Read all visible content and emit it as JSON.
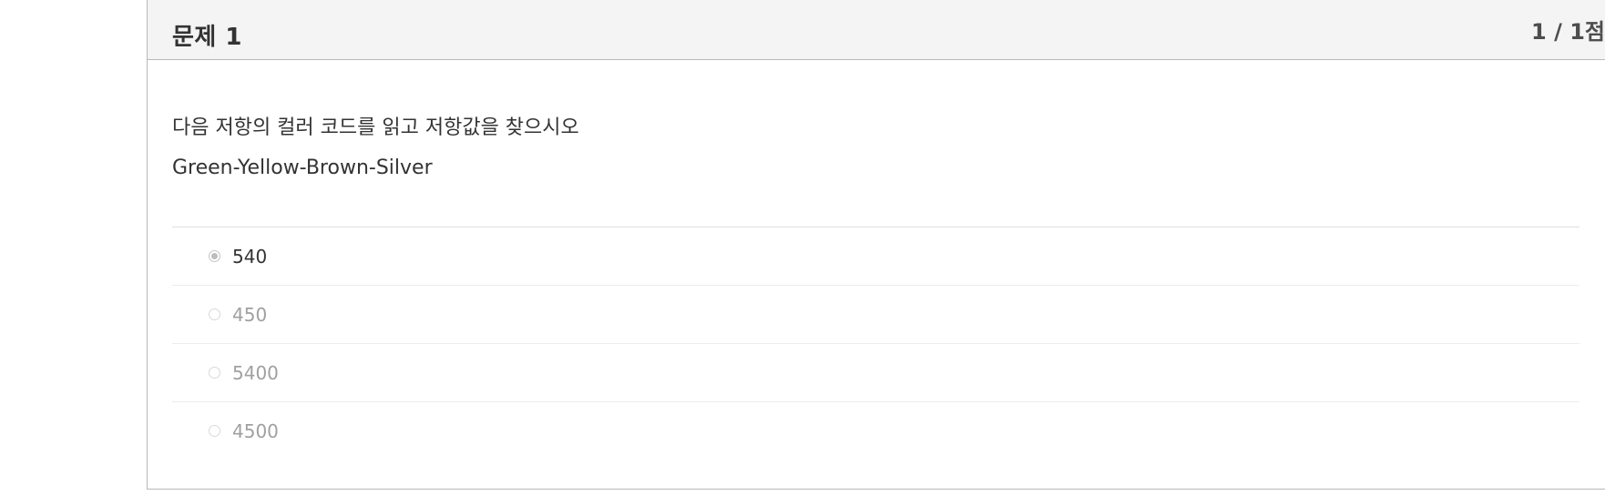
{
  "question": {
    "title": "문제 1",
    "score": "1 / 1점",
    "text": "다음 저항의 컬러 코드를 읽고 저항값을 찾으시오",
    "detail": "Green-Yellow-Brown-Silver",
    "options": [
      {
        "label": "540",
        "selected": true
      },
      {
        "label": "450",
        "selected": false
      },
      {
        "label": "5400",
        "selected": false
      },
      {
        "label": "4500",
        "selected": false
      }
    ]
  },
  "colors": {
    "header_bg": "#f4f4f4",
    "border": "#b8b8b8",
    "text": "#333333",
    "muted_text": "#a0a0a0"
  }
}
